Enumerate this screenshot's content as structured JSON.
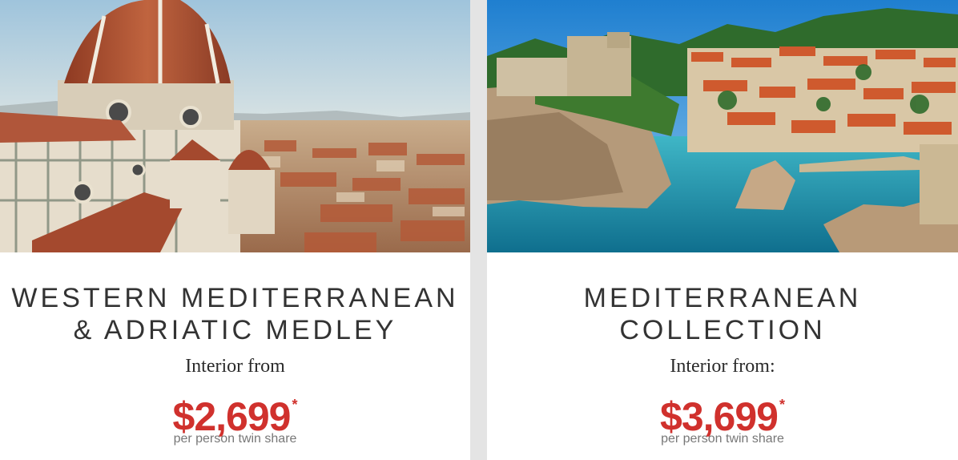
{
  "cards": [
    {
      "image": "florence-cathedral-dome-photo",
      "title_line1": "WESTERN MEDITERRANEAN",
      "title_line2": "& ADRIATIC MEDLEY",
      "from_label": "Interior from",
      "price": "$2,699",
      "asterisk": "*",
      "price_note": "per person twin share"
    },
    {
      "image": "dubrovnik-coastline-photo",
      "title_line1": "MEDITERRANEAN",
      "title_line2": "COLLECTION",
      "from_label": "Interior from:",
      "price": "$3,699",
      "asterisk": "*",
      "price_note": "per person twin share"
    }
  ],
  "colors": {
    "price": "#d0312d",
    "title": "#333333",
    "background": "#e4e4e4",
    "card": "#ffffff"
  }
}
